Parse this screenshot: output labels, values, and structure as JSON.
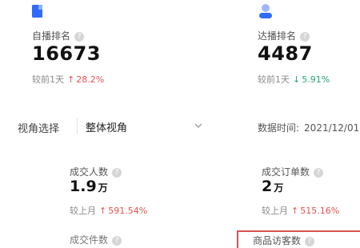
{
  "left_metric": {
    "icon": "document-icon",
    "label": "自播排名",
    "value": "16673",
    "compare_label": "较前1天",
    "change": "28.2%",
    "direction": "up"
  },
  "right_metric": {
    "icon": "user-icon",
    "label": "达播排名",
    "value": "4487",
    "compare_label": "较前1天",
    "change": "5.91%",
    "direction": "down"
  },
  "filters": {
    "view_label": "视角选择",
    "view_value": "整体视角",
    "time_label": "数据时间:",
    "time_value": "2021/12/01"
  },
  "cards": [
    {
      "label": "成交人数",
      "value": "1.9",
      "unit": "万",
      "compare_label": "较上月",
      "change": "591.54%",
      "direction": "up"
    },
    {
      "label": "成交订单数",
      "value": "2",
      "unit": "万",
      "compare_label": "较上月",
      "change": "515.16%",
      "direction": "up"
    }
  ],
  "bottom": {
    "left_label": "成交件数",
    "right_label": "商品访客数"
  },
  "colors": {
    "up": "#e3534f",
    "down": "#22a86b",
    "accent": "#2f6bff",
    "highlight_box": "#d9534f"
  },
  "help_glyph": "?",
  "arrows": {
    "up": "↑",
    "down": "↓"
  }
}
